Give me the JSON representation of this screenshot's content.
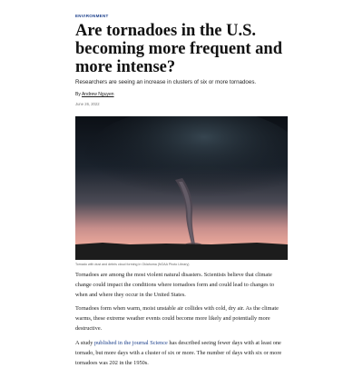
{
  "article": {
    "kicker": "ENVIRONMENT",
    "headline": "Are tornadoes in the U.S. becoming more frequent and more intense?",
    "dek": "Researchers are seeing an increase in clusters of six or more tornadoes.",
    "byline_prefix": "By",
    "author": "Andrew Nguyen",
    "date": "June 26, 2022",
    "image_caption": "Tornado with dust and debris cloud forming in Oklahoma (NOAA Photo Library)",
    "paragraphs": [
      "Tornadoes are among the most violent natural disasters. Scientists believe that climate change could impact the conditions where tornadoes form and could lead to changes to when and where they occur in the United States.",
      "Tornadoes form when warm, moist unstable air collides with cold, dry air. As the climate warms, these extreme weather events could become more likely and potentially more destructive."
    ],
    "p3_start": "A study ",
    "p3_link": "published in the journal Science",
    "p3_rest": " has described seeing fewer days with at least one tornado, but more days with a cluster of six or more. The number of days with six or more tornadoes was 202 in the 1950s."
  },
  "colors": {
    "kicker": "#1b3f8b",
    "link": "#1b3f8b"
  }
}
